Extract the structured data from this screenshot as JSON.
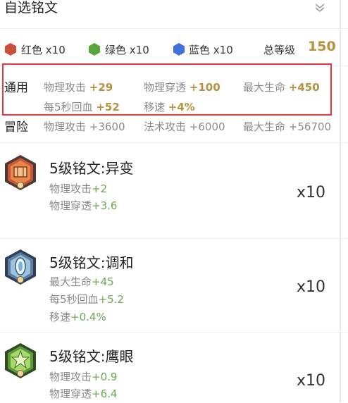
{
  "header": {
    "title": "自选铭文",
    "chevron_icon": "double-chevron-down-icon"
  },
  "colors": {
    "red_label": "红色 x10",
    "green_label": "绿色 x10",
    "blue_label": "蓝色 x10",
    "total_label": "总等级",
    "total_value": "150",
    "red": "#c9503c",
    "green": "#58a63b",
    "blue": "#3f72d8"
  },
  "general": {
    "title": "通用",
    "stats": [
      {
        "name": "物理攻击",
        "value": "+29"
      },
      {
        "name": "物理穿透",
        "value": "+100"
      },
      {
        "name": "最大生命",
        "value": "+450"
      },
      {
        "name": "每5秒回血",
        "value": "+52"
      },
      {
        "name": "移速",
        "value": "+4%"
      }
    ]
  },
  "adventure": {
    "title": "冒险",
    "stats": [
      {
        "name": "物理攻击",
        "value": "+3600"
      },
      {
        "name": "法术攻击",
        "value": "+6000"
      },
      {
        "name": "最大生命",
        "value": "+56700"
      }
    ]
  },
  "runes": [
    {
      "name": "5级铭文:异变",
      "icon": "red-rune-icon",
      "count": "x10",
      "attrs": [
        {
          "name": "物理攻击",
          "value": "+2"
        },
        {
          "name": "物理穿透",
          "value": "+3.6"
        }
      ]
    },
    {
      "name": "5级铭文:调和",
      "icon": "blue-rune-icon",
      "count": "x10",
      "attrs": [
        {
          "name": "最大生命",
          "value": "+45"
        },
        {
          "name": "每5秒回血",
          "value": "+5.2"
        },
        {
          "name": "移速",
          "value": "+0.4%"
        }
      ]
    },
    {
      "name": "5级铭文:鹰眼",
      "icon": "green-rune-icon",
      "count": "x10",
      "attrs": [
        {
          "name": "物理攻击",
          "value": "+0.9"
        },
        {
          "name": "物理穿透",
          "value": "+6.4"
        }
      ]
    }
  ]
}
